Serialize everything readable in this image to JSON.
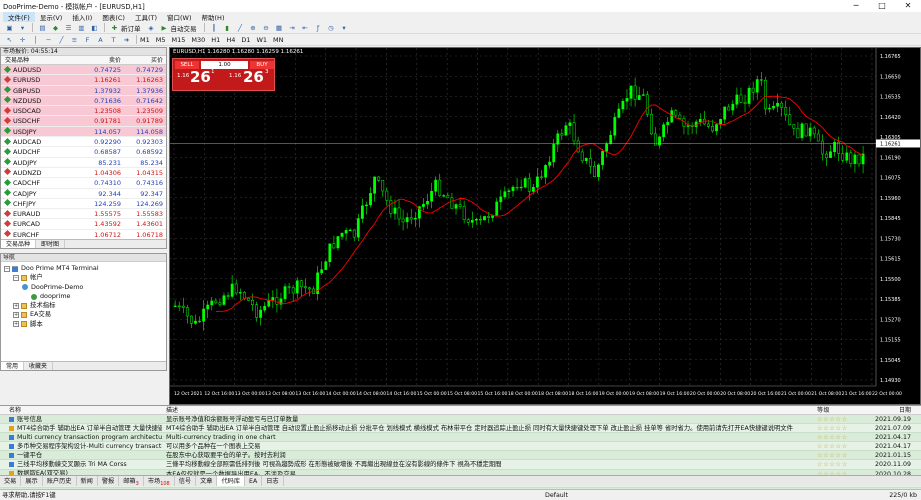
{
  "window": {
    "title": "DooPrime-Demo - 模拟帐户 - [EURUSD,H1]",
    "min": "─",
    "max": "□",
    "close": "✕"
  },
  "menu": [
    "文件(F)",
    "显示(V)",
    "插入(I)",
    "图表(C)",
    "工具(T)",
    "窗口(W)",
    "帮助(H)"
  ],
  "toolbar": {
    "new_order": "新订单",
    "auto_trade": "自动交易",
    "timeframes": [
      "M1",
      "M5",
      "M15",
      "M30",
      "H1",
      "H4",
      "D1",
      "W1",
      "MN"
    ]
  },
  "market_watch": {
    "title": "市场报价: 04:55:14",
    "col_symbol": "交易品种",
    "col_bid": "卖价",
    "col_ask": "买价",
    "rows": [
      {
        "symbol": "AUDUSD",
        "bid": "0.74725",
        "ask": "0.74729",
        "dir": "up",
        "hl": true
      },
      {
        "symbol": "EURUSD",
        "bid": "1.16261",
        "ask": "1.16263",
        "dir": "dn",
        "hl": true
      },
      {
        "symbol": "GBPUSD",
        "bid": "1.37932",
        "ask": "1.37936",
        "dir": "up",
        "hl": true
      },
      {
        "symbol": "NZDUSD",
        "bid": "0.71636",
        "ask": "0.71642",
        "dir": "up",
        "hl": true
      },
      {
        "symbol": "USDCAD",
        "bid": "1.23508",
        "ask": "1.23509",
        "dir": "dn",
        "hl": true
      },
      {
        "symbol": "USDCHF",
        "bid": "0.91781",
        "ask": "0.91789",
        "dir": "dn",
        "hl": true
      },
      {
        "symbol": "USDJPY",
        "bid": "114.057",
        "ask": "114.058",
        "dir": "up",
        "hl": true
      },
      {
        "symbol": "AUDCAD",
        "bid": "0.92290",
        "ask": "0.92303",
        "dir": "up",
        "hl": false
      },
      {
        "symbol": "AUDCHF",
        "bid": "0.68587",
        "ask": "0.68592",
        "dir": "up",
        "hl": false
      },
      {
        "symbol": "AUDJPY",
        "bid": "85.231",
        "ask": "85.234",
        "dir": "up",
        "hl": false
      },
      {
        "symbol": "AUDNZD",
        "bid": "1.04306",
        "ask": "1.04315",
        "dir": "dn",
        "hl": false
      },
      {
        "symbol": "CADCHF",
        "bid": "0.74310",
        "ask": "0.74316",
        "dir": "up",
        "hl": false
      },
      {
        "symbol": "CADJPY",
        "bid": "92.344",
        "ask": "92.347",
        "dir": "up",
        "hl": false
      },
      {
        "symbol": "CHFJPY",
        "bid": "124.259",
        "ask": "124.269",
        "dir": "up",
        "hl": false
      },
      {
        "symbol": "EURAUD",
        "bid": "1.55575",
        "ask": "1.55583",
        "dir": "dn",
        "hl": false
      },
      {
        "symbol": "EURCAD",
        "bid": "1.43592",
        "ask": "1.43601",
        "dir": "dn",
        "hl": false
      },
      {
        "symbol": "EURCHF",
        "bid": "1.06712",
        "ask": "1.06718",
        "dir": "dn",
        "hl": false
      }
    ],
    "tabs": [
      "交易品种",
      "即时图"
    ]
  },
  "navigator": {
    "title": "导航",
    "items": [
      {
        "label": "Doo Prime MT4 Terminal",
        "level": 0,
        "icon": "terminal"
      },
      {
        "label": "帐户",
        "level": 1,
        "icon": "folder"
      },
      {
        "label": "DooPrime-Demo",
        "level": 2,
        "icon": "account"
      },
      {
        "label": "dooprime",
        "level": 3,
        "icon": "user"
      },
      {
        "label": "技术指标",
        "level": 1,
        "icon": "folder"
      },
      {
        "label": "EA交易",
        "level": 1,
        "icon": "folder"
      },
      {
        "label": "脚本",
        "level": 1,
        "icon": "folder"
      }
    ],
    "tabs": [
      "常用",
      "收藏夹"
    ]
  },
  "chart": {
    "header": "EURUSD,H1  1.16280 1.16280 1.16259 1.16261",
    "sell_label": "SELL",
    "buy_label": "BUY",
    "lot": "1.00",
    "sell_big": "1.16",
    "sell_pips": "26",
    "sell_sup": "1",
    "buy_big": "1.16",
    "buy_pips": "26",
    "buy_sup": "3",
    "current_price": "1.16261",
    "y_ticks": [
      "1.16765",
      "1.16650",
      "1.16535",
      "1.16420",
      "1.16305",
      "1.16190",
      "1.16075",
      "1.15960",
      "1.15845",
      "1.15730",
      "1.15615",
      "1.15500",
      "1.15385",
      "1.15270",
      "1.15155",
      "1.15045",
      "1.14930"
    ],
    "x_ticks": [
      "12 Oct 2021",
      "12 Oct 16:00",
      "13 Oct 00:00",
      "13 Oct 08:00",
      "13 Oct 16:00",
      "14 Oct 00:00",
      "14 Oct 08:00",
      "14 Oct 16:00",
      "15 Oct 00:00",
      "15 Oct 08:00",
      "15 Oct 16:00",
      "18 Oct 00:00",
      "18 Oct 08:00",
      "18 Oct 16:00",
      "19 Oct 00:00",
      "19 Oct 08:00",
      "19 Oct 16:00",
      "20 Oct 00:00",
      "20 Oct 08:00",
      "20 Oct 16:00",
      "21 Oct 00:00",
      "21 Oct 08:00",
      "21 Oct 16:00",
      "22 Oct 00:00"
    ],
    "bull_color": "#00ff00",
    "ma_color": "#ff0000",
    "bg_color": "#000000"
  },
  "terminal": {
    "col_name": "名称",
    "col_desc": "描述",
    "col_rating": "等级",
    "col_date": "日期",
    "rows": [
      {
        "name": "账号信息",
        "desc": "显示账号净值和余额账号浮动盈亏与已订单数量",
        "rating": "☆☆☆☆☆",
        "date": "2021.09.19"
      },
      {
        "name": "MT4综合助手 辅助出EA 订单半自动管理 大量快捷键",
        "desc": "MT4综合助手 辅助出EA 订单半自动管理 自动设置止盈止损移动止损 分批平仓 划线模式 横线模式 布林带平仓 定时器追踪止盈止损 同时有大量快捷键处理下单 改止盈止损 挂单等 省时省力。使用前请先打开EA快捷键说明文件",
        "rating": "☆☆☆☆☆",
        "date": "2021.07.09"
      },
      {
        "name": "Multi currency transaction program architecture des...",
        "desc": "Multi-currency trading in one chart",
        "rating": "☆☆☆☆☆",
        "date": "2021.04.17"
      },
      {
        "name": "多币种交易程序架构设计-Multi currency transaction pr...",
        "desc": "可以用多个品种在一个图表上交易",
        "rating": "☆☆☆☆☆",
        "date": "2021.04.17"
      },
      {
        "name": "一键平仓",
        "desc": "在股东中心获取要平仓的单子。按时去利润",
        "rating": "☆☆☆☆☆",
        "date": "2021.01.15"
      },
      {
        "name": "三线平均移動練交叉顯示 Tri MA Corss",
        "desc": "三條平均移動線全部照需低排列後 可視為趨勢成形 在形態被破壞後 不再繼出現線並在沒有影線的條件下 視為不穩定期間",
        "rating": "☆☆☆☆☆",
        "date": "2020.11.09"
      },
      {
        "name": "数据取EA(双交易)",
        "desc": "本EA仅仅就是一个数据导出用EA。不涉及交易",
        "rating": "☆☆☆☆☆",
        "date": "2020.10.28"
      },
      {
        "name": "雙平均移動線交叉顯示 Double MA Cross",
        "desc": "兩條平均移動線交叉後醒路最出影線 繼書表要音顯間隔",
        "rating": "☆☆☆☆☆",
        "date": "2020.09.25"
      },
      {
        "name": "",
        "desc": "Sm Better Sclper Fa",
        "rating": "☆☆☆☆☆",
        "date": "2020.09.11"
      }
    ]
  },
  "bottom_tabs": [
    {
      "label": "交易",
      "badge": ""
    },
    {
      "label": "展示",
      "badge": ""
    },
    {
      "label": "账户历史",
      "badge": ""
    },
    {
      "label": "新闻",
      "badge": ""
    },
    {
      "label": "警报",
      "badge": ""
    },
    {
      "label": "邮箱",
      "badge": "3"
    },
    {
      "label": "市场",
      "badge": "108"
    },
    {
      "label": "信号",
      "badge": ""
    },
    {
      "label": "文章",
      "badge": ""
    },
    {
      "label": "代码库",
      "badge": "",
      "on": true
    },
    {
      "label": "EA",
      "badge": ""
    },
    {
      "label": "日志",
      "badge": ""
    }
  ],
  "status": {
    "help": "寻求帮助,请按F1键",
    "profile": "Default",
    "traffic": "225/0 kb"
  }
}
